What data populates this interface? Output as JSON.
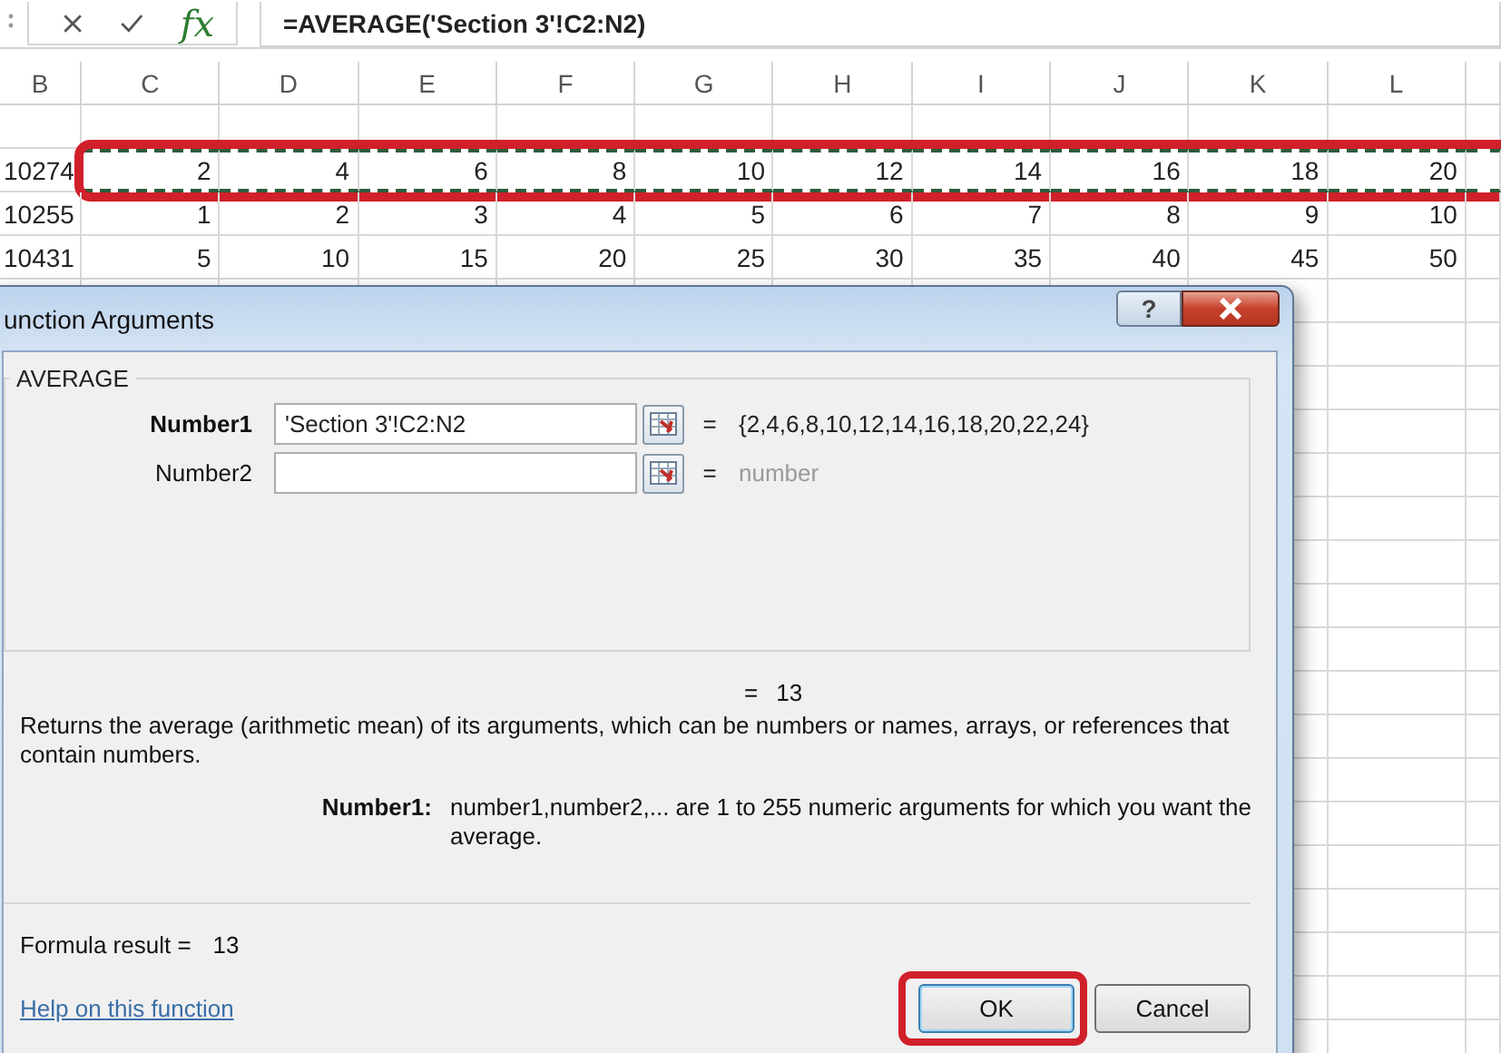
{
  "formula_bar": {
    "function_label": "fx",
    "formula": "=AVERAGE('Section 3'!C2:N2)"
  },
  "sheet": {
    "columns": [
      "B",
      "C",
      "D",
      "E",
      "F",
      "G",
      "H",
      "I",
      "J",
      "K",
      "L"
    ],
    "rows": [
      {
        "cells": [
          "10274",
          "2",
          "4",
          "6",
          "8",
          "10",
          "12",
          "14",
          "16",
          "18",
          "20"
        ],
        "referenced": true,
        "circled": true
      },
      {
        "cells": [
          "10255",
          "1",
          "2",
          "3",
          "4",
          "5",
          "6",
          "7",
          "8",
          "9",
          "10"
        ]
      },
      {
        "cells": [
          "10431",
          "5",
          "10",
          "15",
          "20",
          "25",
          "30",
          "35",
          "40",
          "45",
          "50"
        ]
      }
    ]
  },
  "dialog": {
    "title": "unction Arguments",
    "help_button": "?",
    "function_name": "AVERAGE",
    "arguments": [
      {
        "label": "Number1",
        "required": true,
        "value": "'Section 3'!C2:N2",
        "sign": "=",
        "result": "{2,4,6,8,10,12,14,16,18,20,22,24}",
        "muted": false
      },
      {
        "label": "Number2",
        "required": false,
        "sign": "=",
        "result": "number",
        "muted": true
      }
    ],
    "result_sign": "=",
    "result": "13",
    "description": "Returns the average (arithmetic mean) of its arguments, which can be numbers or names, arrays, or references that contain numbers.",
    "argument_help": {
      "label": "Number1:",
      "text": "number1,number2,... are 1 to 255 numeric arguments for which you want the average."
    },
    "formula_result_label": "Formula result =",
    "formula_result": "13",
    "help_link": "Help on this function",
    "buttons": [
      {
        "label": "OK",
        "default": true,
        "circled": true
      },
      {
        "label": "Cancel",
        "default": false,
        "circled": false
      }
    ]
  }
}
